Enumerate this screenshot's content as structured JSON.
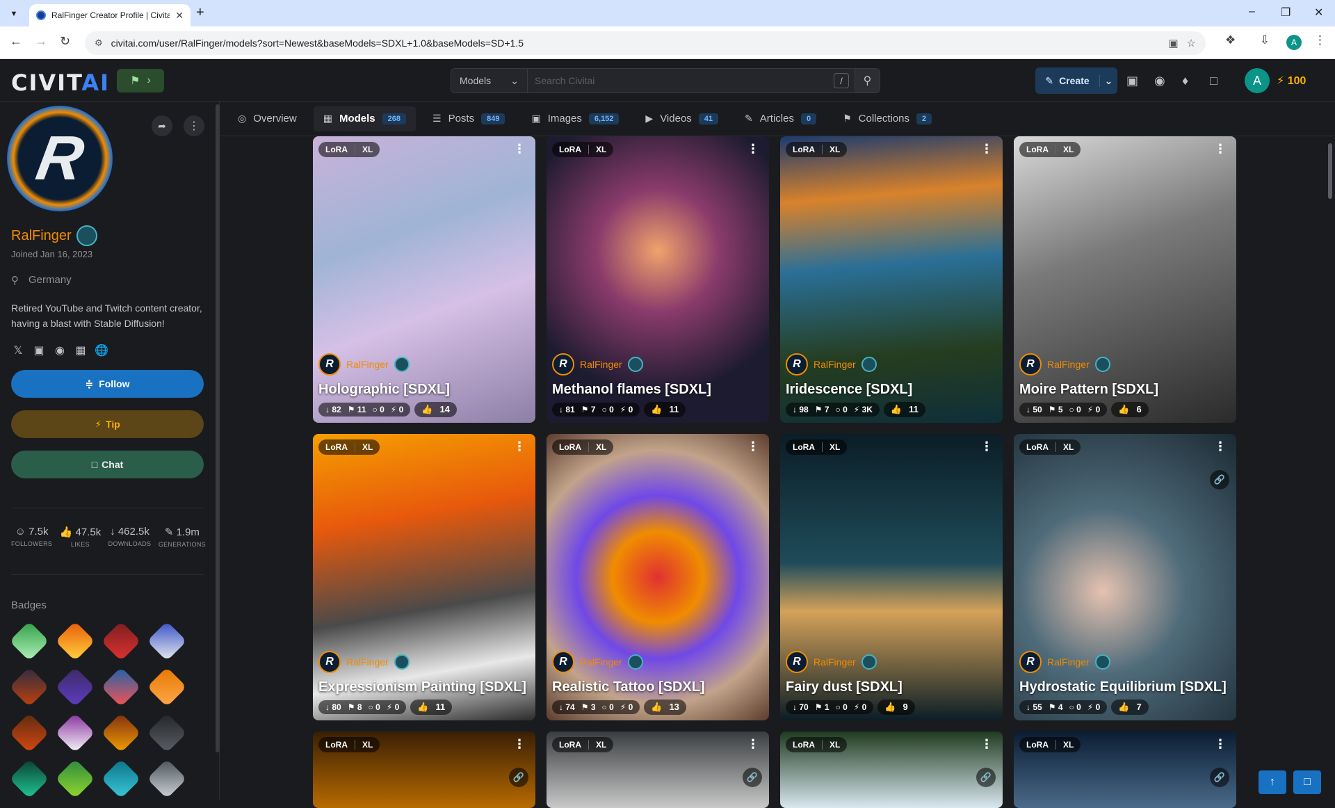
{
  "browser": {
    "tab_title": "RalFinger Creator Profile | Civitai",
    "url": "civitai.com/user/RalFinger/models?sort=Newest&baseModels=SDXL+1.0&baseModels=SD+1.5",
    "profile_initial": "A"
  },
  "header": {
    "logo_main": "CIVIT",
    "logo_ai": "AI",
    "search_category": "Models",
    "search_placeholder": "Search Civitai",
    "search_shortcut": "/",
    "create_label": "Create",
    "avatar_initial": "A",
    "buzz_amount": "100"
  },
  "profile": {
    "username": "RalFinger",
    "joined": "Joined Jan 16, 2023",
    "location": "Germany",
    "bio": "Retired YouTube and Twitch content creator, having a blast with Stable Diffusion!",
    "follow_label": "Follow",
    "tip_label": "Tip",
    "chat_label": "Chat",
    "stats": [
      {
        "value": "7.5k",
        "label": "FOLLOWERS",
        "icon": "user-icon"
      },
      {
        "value": "47.5k",
        "label": "LIKES",
        "icon": "thumb-icon"
      },
      {
        "value": "462.5k",
        "label": "DOWNLOADS",
        "icon": "download-icon"
      },
      {
        "value": "1.9m",
        "label": "GENERATIONS",
        "icon": "brush-icon"
      }
    ],
    "badges_title": "Badges"
  },
  "tabs": [
    {
      "label": "Overview",
      "count": null,
      "icon": "overview-icon"
    },
    {
      "label": "Models",
      "count": "268",
      "icon": "grid-icon"
    },
    {
      "label": "Posts",
      "count": "849",
      "icon": "posts-icon"
    },
    {
      "label": "Images",
      "count": "6,152",
      "icon": "image-icon"
    },
    {
      "label": "Videos",
      "count": "41",
      "icon": "video-icon"
    },
    {
      "label": "Articles",
      "count": "0",
      "icon": "pencil-icon"
    },
    {
      "label": "Collections",
      "count": "2",
      "icon": "bookmark-icon"
    }
  ],
  "card_tags": {
    "type": "LoRA",
    "base": "XL"
  },
  "models": [
    {
      "name": "Holographic [SDXL]",
      "downloads": "82",
      "saves": "11",
      "comments": "0",
      "buzz": "0",
      "likes": "14"
    },
    {
      "name": "Methanol flames [SDXL]",
      "downloads": "81",
      "saves": "7",
      "comments": "0",
      "buzz": "0",
      "likes": "11"
    },
    {
      "name": "Iridescence [SDXL]",
      "downloads": "98",
      "saves": "7",
      "comments": "0",
      "buzz": "3K",
      "likes": "11"
    },
    {
      "name": "Moire Pattern [SDXL]",
      "downloads": "50",
      "saves": "5",
      "comments": "0",
      "buzz": "0",
      "likes": "6"
    },
    {
      "name": "Expressionism Painting [SDXL]",
      "downloads": "80",
      "saves": "8",
      "comments": "0",
      "buzz": "0",
      "likes": "11"
    },
    {
      "name": "Realistic Tattoo [SDXL]",
      "downloads": "74",
      "saves": "3",
      "comments": "0",
      "buzz": "0",
      "likes": "13"
    },
    {
      "name": "Fairy dust [SDXL]",
      "downloads": "70",
      "saves": "1",
      "comments": "0",
      "buzz": "0",
      "likes": "9"
    },
    {
      "name": "Hydrostatic Equilibrium [SDXL]",
      "downloads": "55",
      "saves": "4",
      "comments": "0",
      "buzz": "0",
      "likes": "7"
    }
  ],
  "colors": {
    "accent_blue": "#1971c2",
    "username_orange": "#f08c00",
    "buzz_yellow": "#fab005",
    "background": "#1a1b1e"
  }
}
